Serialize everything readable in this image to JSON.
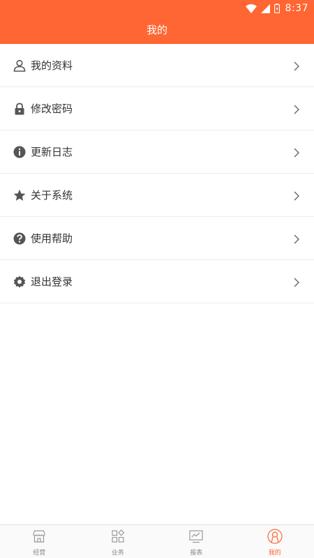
{
  "status": {
    "time": "8:37"
  },
  "header": {
    "title": "我的"
  },
  "menu": [
    {
      "label": "我的资料",
      "icon": "person-icon"
    },
    {
      "label": "修改密码",
      "icon": "lock-icon"
    },
    {
      "label": "更新日志",
      "icon": "info-icon"
    },
    {
      "label": "关于系统",
      "icon": "star-icon"
    },
    {
      "label": "使用帮助",
      "icon": "help-icon"
    },
    {
      "label": "退出登录",
      "icon": "gear-icon"
    }
  ],
  "tabs": [
    {
      "label": "经营",
      "icon": "store-icon"
    },
    {
      "label": "业务",
      "icon": "apps-icon"
    },
    {
      "label": "报表",
      "icon": "report-icon"
    },
    {
      "label": "我的",
      "icon": "profile-icon",
      "active": true
    }
  ],
  "colors": {
    "accent": "#ff6633",
    "icon": "#555555",
    "inactive": "#888888"
  }
}
